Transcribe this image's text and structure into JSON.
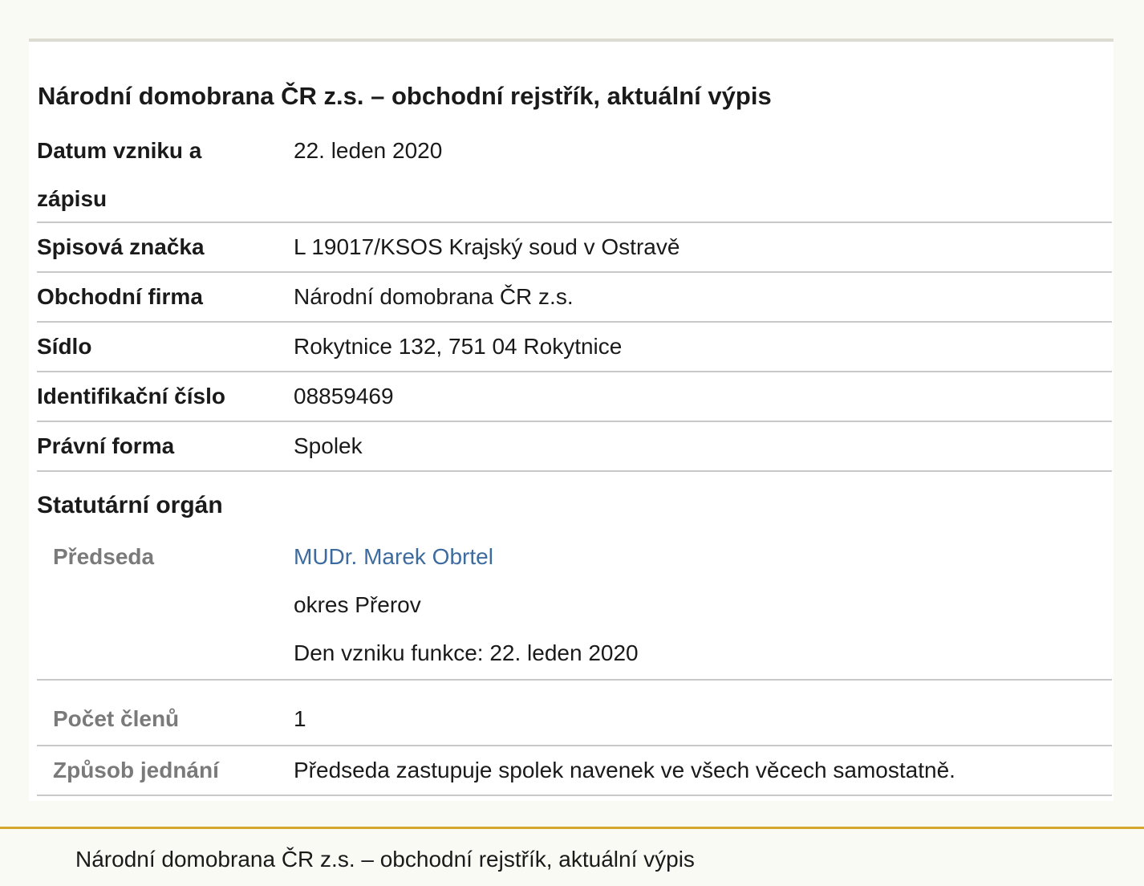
{
  "document": {
    "title": "Národní domobrana ČR z.s. – obchodní rejstřík, aktuální výpis",
    "rows": [
      {
        "label": "Datum vzniku a zápisu",
        "value": "22. leden 2020"
      },
      {
        "label": "Spisová značka",
        "value": "L 19017/KSOS Krajský soud v Ostravě"
      },
      {
        "label": "Obchodní firma",
        "value": "Národní domobrana ČR z.s."
      },
      {
        "label": "Sídlo",
        "value": "Rokytnice 132, 751 04 Rokytnice"
      },
      {
        "label": "Identifikační číslo",
        "value": "08859469"
      },
      {
        "label": "Právní forma",
        "value": "Spolek"
      }
    ],
    "statutory": {
      "heading": "Statutární orgán",
      "chair": {
        "label": "Předseda",
        "name": "MUDr. Marek Obrtel",
        "district": "okres Přerov",
        "since": "Den vzniku funkce: 22. leden 2020"
      },
      "member_count": {
        "label": "Počet členů",
        "value": "1"
      },
      "representation": {
        "label": "Způsob jednání",
        "value": "Předseda zastupuje spolek navenek ve všech věcech samostatně."
      }
    }
  },
  "footer": {
    "text": "Národní domobrana ČR z.s. – obchodní rejstřík, aktuální výpis"
  }
}
